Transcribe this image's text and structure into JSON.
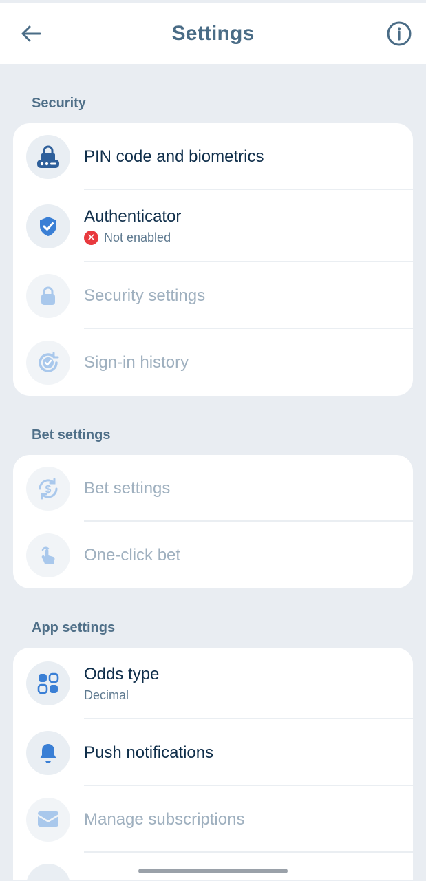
{
  "header": {
    "title": "Settings"
  },
  "sections": {
    "security": {
      "title": "Security",
      "items": [
        {
          "label": "PIN code and biometrics"
        },
        {
          "label": "Authenticator",
          "sub": "Not enabled",
          "status_icon": "x-circle-icon"
        },
        {
          "label": "Security settings"
        },
        {
          "label": "Sign-in history"
        }
      ]
    },
    "bet": {
      "title": "Bet settings",
      "items": [
        {
          "label": "Bet settings"
        },
        {
          "label": "One-click bet"
        }
      ]
    },
    "app": {
      "title": "App settings",
      "items": [
        {
          "label": "Odds type",
          "sub": "Decimal"
        },
        {
          "label": "Push notifications"
        },
        {
          "label": "Manage subscriptions"
        }
      ]
    }
  },
  "colors": {
    "accent": "#4a86d6",
    "accent_light": "#a9c8ec",
    "title": "#4a6c86",
    "text": "#0f2e4a",
    "muted": "#9fb0bf",
    "error": "#e8393e",
    "background": "#e9edf2"
  }
}
